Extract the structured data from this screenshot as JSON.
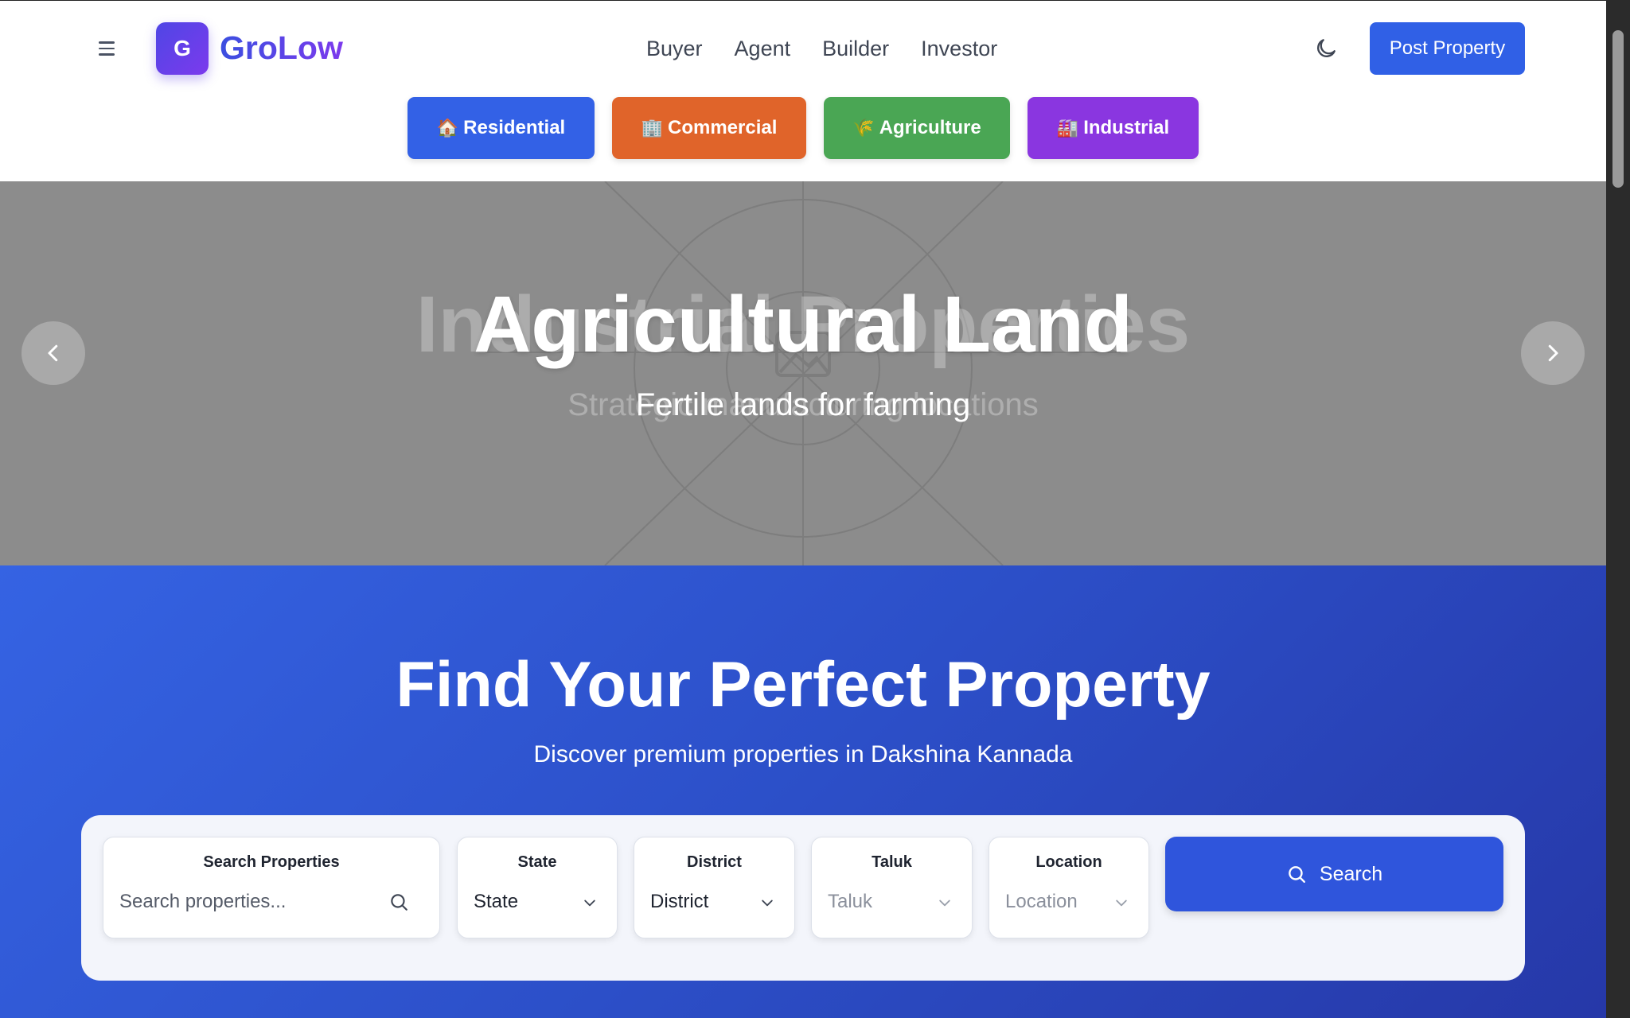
{
  "brand": {
    "badge_letter": "G",
    "name": "GroLow"
  },
  "nav": [
    "Buyer",
    "Agent",
    "Builder",
    "Investor"
  ],
  "header": {
    "post_label": "Post Property"
  },
  "categories": [
    {
      "emoji": "🏠",
      "label": "Residential",
      "color": "#3361e6"
    },
    {
      "emoji": "🏢",
      "label": "Commercial",
      "color": "#e0642a"
    },
    {
      "emoji": "🌾",
      "label": "Agriculture",
      "color": "#4aa654"
    },
    {
      "emoji": "🏭",
      "label": "Industrial",
      "color": "#8a36e0"
    }
  ],
  "hero": {
    "title": "Agricultural Land",
    "subtitle": "Fertile lands for farming",
    "prev_title": "Industrial Properties",
    "prev_subtitle": "Strategic manufacturing locations"
  },
  "find": {
    "title": "Find Your Perfect Property",
    "subtitle": "Discover premium properties in Dakshina Kannada"
  },
  "search": {
    "query_label": "Search Properties",
    "query_placeholder": "Search properties...",
    "state_label": "State",
    "state_value": "State",
    "district_label": "District",
    "district_value": "District",
    "taluk_label": "Taluk",
    "taluk_value": "Taluk",
    "location_label": "Location",
    "location_value": "Location",
    "button_label": "Search"
  },
  "colors": {
    "primary": "#3060e6",
    "hero_bg": "#8c8c8c"
  }
}
